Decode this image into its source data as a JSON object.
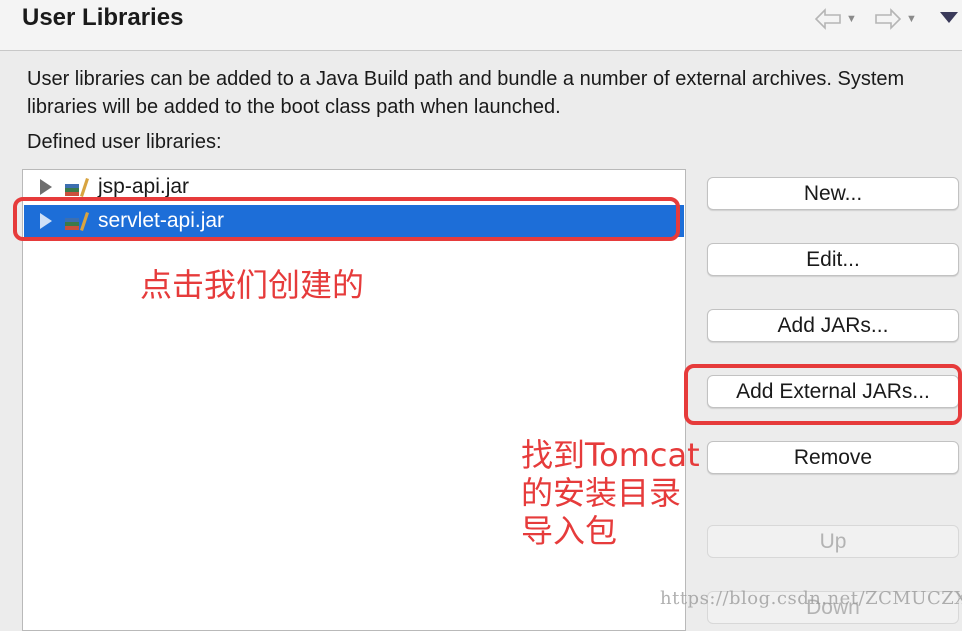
{
  "header": {
    "title": "User Libraries",
    "back_icon": "back-arrow-icon",
    "forward_icon": "forward-arrow-icon",
    "view_menu_icon": "view-menu-icon"
  },
  "description": "User libraries can be added to a Java Build path and bundle a number of external archives. System libraries will be added to the boot class path when launched.",
  "defined_label": "Defined user libraries:",
  "libraries": [
    {
      "label": "jsp-api.jar",
      "selected": false,
      "icon": "library-icon"
    },
    {
      "label": "servlet-api.jar",
      "selected": true,
      "icon": "library-icon"
    }
  ],
  "buttons": {
    "new": "New...",
    "edit": "Edit...",
    "add_jars": "Add JARs...",
    "add_external_jars": "Add External JARs...",
    "remove": "Remove",
    "up": "Up",
    "down": "Down"
  },
  "annotations": {
    "select_hint": "点击我们创建的",
    "import_hint_line1": "找到Tomcat",
    "import_hint_line2": "的安装目录",
    "import_hint_line3": "导入包",
    "color": "#e63b3b"
  },
  "watermark": "https://blog.csdn.net/ZCMUCZX",
  "colors": {
    "selection": "#1d6ed8",
    "background": "#ececec"
  }
}
